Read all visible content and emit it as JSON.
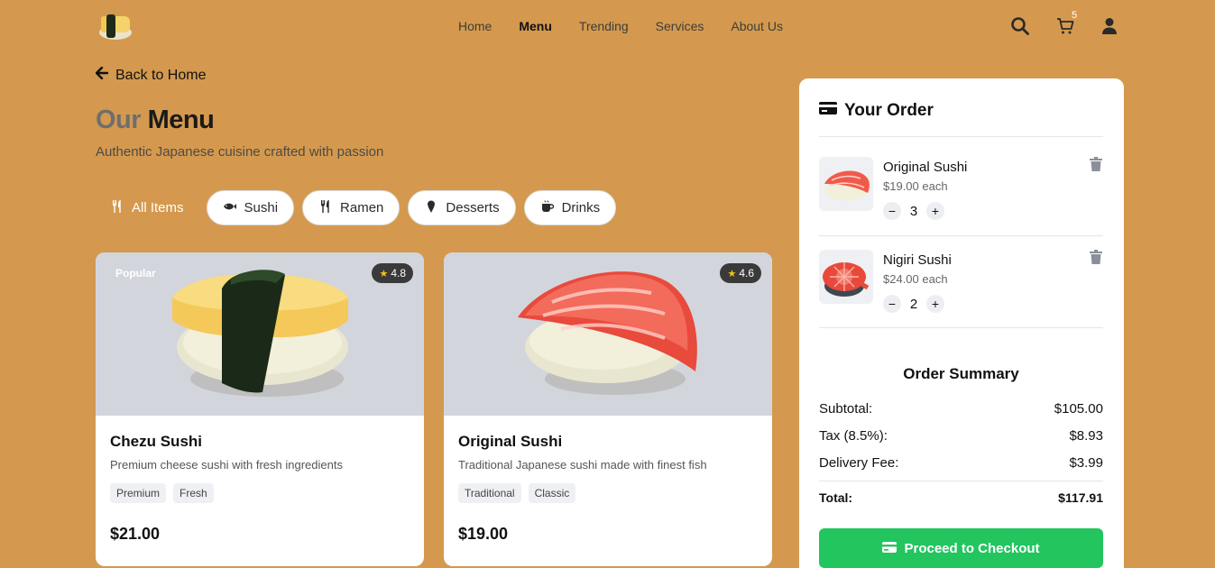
{
  "nav": {
    "items": [
      {
        "label": "Home"
      },
      {
        "label": "Menu",
        "active": true
      },
      {
        "label": "Trending"
      },
      {
        "label": "Services"
      },
      {
        "label": "About Us"
      }
    ],
    "cart_count": "5",
    "icons": [
      "search-icon",
      "cart-icon",
      "user-icon"
    ]
  },
  "back_link": "Back to Home",
  "page": {
    "title_muted": "Our",
    "title_main": "Menu",
    "subtitle": "Authentic Japanese cuisine crafted with passion"
  },
  "filters": [
    {
      "label": "All Items",
      "icon": "utensils-icon",
      "active": true
    },
    {
      "label": "Sushi",
      "icon": "fish-icon"
    },
    {
      "label": "Ramen",
      "icon": "utensils-icon"
    },
    {
      "label": "Desserts",
      "icon": "ice-cream-icon"
    },
    {
      "label": "Drinks",
      "icon": "mug-icon"
    }
  ],
  "cards": [
    {
      "badge": "Popular",
      "rating": "4.8",
      "name": "Chezu Sushi",
      "desc": "Premium cheese sushi with fresh ingredients",
      "tags": [
        "Premium",
        "Fresh"
      ],
      "price": "$21.00"
    },
    {
      "badge": "",
      "rating": "4.6",
      "name": "Original Sushi",
      "desc": "Traditional Japanese sushi made with finest fish",
      "tags": [
        "Traditional",
        "Classic"
      ],
      "price": "$19.00"
    }
  ],
  "order": {
    "title": "Your Order",
    "items": [
      {
        "name": "Original Sushi",
        "each": "$19.00 each",
        "qty": "3"
      },
      {
        "name": "Nigiri Sushi",
        "each": "$24.00 each",
        "qty": "2"
      }
    ],
    "summary": {
      "title": "Order Summary",
      "rows": [
        {
          "label": "Subtotal:",
          "value": "$105.00"
        },
        {
          "label": "Tax (8.5%):",
          "value": "$8.93"
        },
        {
          "label": "Delivery Fee:",
          "value": "$3.99"
        }
      ],
      "total_label": "Total:",
      "total_value": "$117.91"
    },
    "checkout_label": "Proceed to Checkout"
  },
  "colors": {
    "background": "#d4994e",
    "checkout_green": "#22c55e",
    "image_bg": "#d3d5dd"
  }
}
